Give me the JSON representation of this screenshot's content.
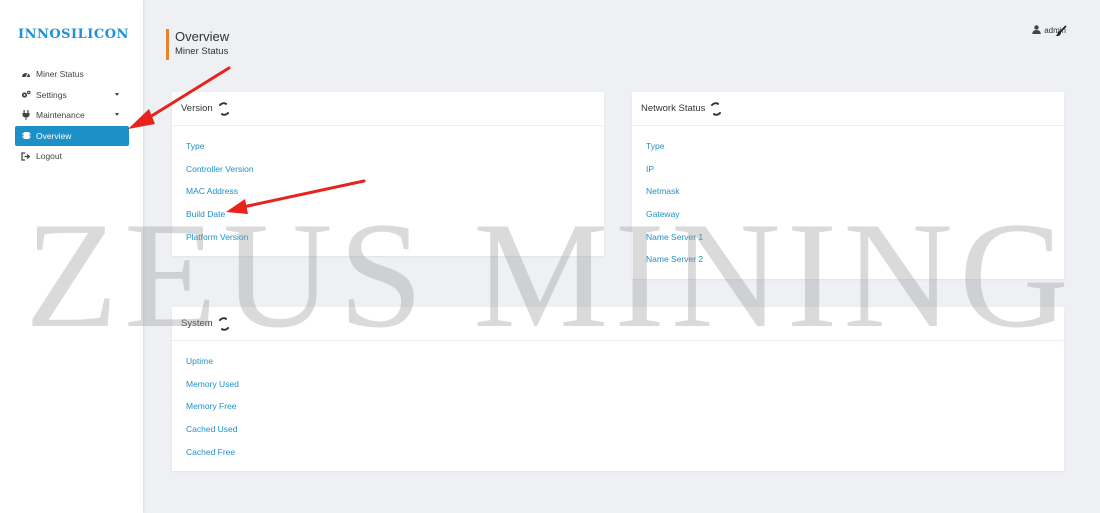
{
  "brand": {
    "logo": "INNOSILICON"
  },
  "sidebar": {
    "items": [
      {
        "label": "Miner Status",
        "icon": "dashboard-icon"
      },
      {
        "label": "Settings",
        "icon": "gears-icon"
      },
      {
        "label": "Maintenance",
        "icon": "plug-icon"
      },
      {
        "label": "Overview",
        "icon": "chip-icon",
        "active": true
      },
      {
        "label": "Logout",
        "icon": "sign-out-icon"
      }
    ]
  },
  "header": {
    "title": "Overview",
    "subtitle": "Miner Status",
    "user": "admin"
  },
  "cards": {
    "version": {
      "title": "Version",
      "rows": [
        "Type",
        "Controller Version",
        "MAC Address",
        "Build Date",
        "Platform Version"
      ]
    },
    "network": {
      "title": "Network Status",
      "rows": [
        "Type",
        "IP",
        "Netmask",
        "Gateway",
        "Name Server 1",
        "Name Server 2"
      ]
    },
    "system": {
      "title": "System",
      "rows": [
        "Uptime",
        "Memory Used",
        "Memory Free",
        "Cached Used",
        "Cached Free"
      ]
    }
  },
  "watermark": "ZEUS MINING",
  "colors": {
    "accent": "#1e90c8",
    "title_bar": "#e8822d",
    "arrow": "#e8231b"
  }
}
